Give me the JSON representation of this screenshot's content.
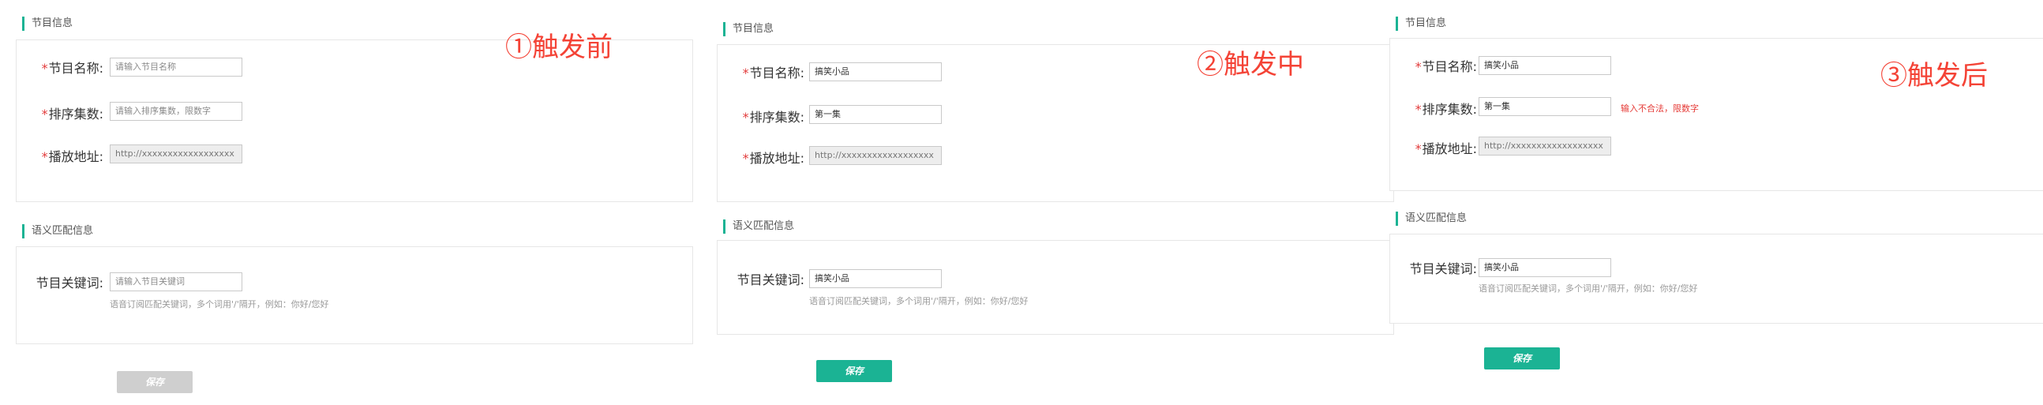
{
  "sections": {
    "program_info": "节目信息",
    "semantic_info": "语义匹配信息"
  },
  "labels": {
    "name": "节目名称:",
    "order": "排序集数:",
    "url": "播放地址:",
    "keywords": "节目关键词:",
    "required_mark": "*"
  },
  "keywords_hint": "语音订阅匹配关键词，多个词用'/'隔开，例如：你好/您好",
  "panels": [
    {
      "stage": "①触发前",
      "name_value": "请输入节目名称",
      "order_value": "请输入排序集数，限数字",
      "url_value": "http://xxxxxxxxxxxxxxxxxx",
      "keywords_value": "请输入节目关键词",
      "error": "",
      "save": "保存",
      "save_state": "disabled"
    },
    {
      "stage": "②触发中",
      "name_value": "搞笑小品",
      "order_value": "第一集",
      "url_value": "http://xxxxxxxxxxxxxxxxxx",
      "keywords_value": "搞笑小品",
      "error": "",
      "save": "保存",
      "save_state": "active"
    },
    {
      "stage": "③触发后",
      "name_value": "搞笑小品",
      "order_value": "第一集",
      "url_value": "http://xxxxxxxxxxxxxxxxxx",
      "keywords_value": "搞笑小品",
      "error": "输入不合法，限数字",
      "save": "保存",
      "save_state": "active"
    }
  ]
}
